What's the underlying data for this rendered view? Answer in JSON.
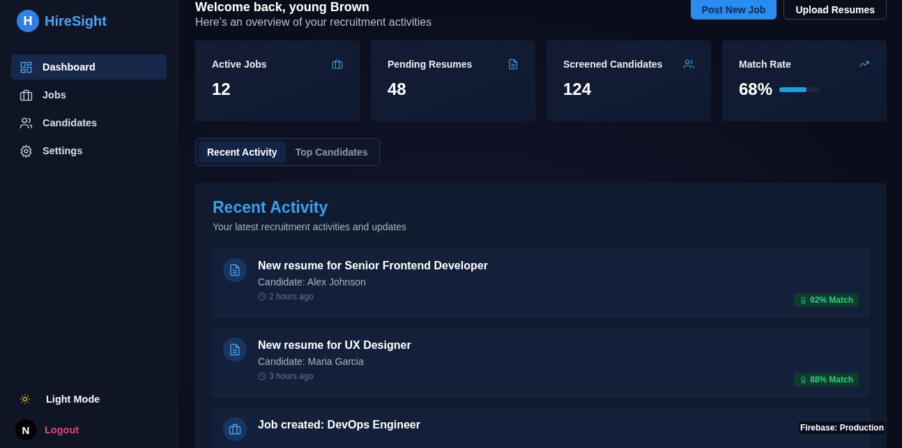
{
  "brand": {
    "initial": "H",
    "name": "HireSight"
  },
  "nav": [
    {
      "label": "Dashboard",
      "kind": "dashboard",
      "selected": true
    },
    {
      "label": "Jobs",
      "kind": "briefcase",
      "selected": false
    },
    {
      "label": "Candidates",
      "kind": "users",
      "selected": false
    },
    {
      "label": "Settings",
      "kind": "gear",
      "selected": false
    }
  ],
  "theme_toggle": {
    "label": "Light Mode"
  },
  "logout": {
    "label": "Logout"
  },
  "dev_badge": {
    "initial": "N"
  },
  "header": {
    "title": "Welcome back, young Brown",
    "subtitle": "Here's an overview of your recruitment activities"
  },
  "actions": [
    {
      "label": "Post New Job",
      "kind": "primary"
    },
    {
      "label": "Upload Resumes",
      "kind": "outline"
    }
  ],
  "stats": [
    {
      "label": "Active Jobs",
      "value": "12",
      "kind": "briefcase"
    },
    {
      "label": "Pending Resumes",
      "value": "48",
      "kind": "file"
    },
    {
      "label": "Screened Candidates",
      "value": "124",
      "kind": "users"
    },
    {
      "label": "Match Rate",
      "value": "68%",
      "kind": "trend",
      "level": 0.68
    }
  ],
  "tabs": [
    {
      "label": "Recent Activity",
      "selected": true
    },
    {
      "label": "Top Candidates",
      "selected": false
    }
  ],
  "panel": {
    "title": "Recent Activity",
    "subtitle": "Your latest recruitment activities and updates"
  },
  "activities": [
    {
      "kind": "file",
      "title": "New resume for Senior Frontend Developer",
      "detail": "Candidate: Alex Johnson",
      "time": "2 hours ago",
      "match": "92% Match"
    },
    {
      "kind": "file",
      "title": "New resume for UX Designer",
      "detail": "Candidate: Maria Garcia",
      "time": "3 hours ago",
      "match": "88% Match"
    },
    {
      "kind": "briefcase",
      "title": "Job created: DevOps Engineer"
    }
  ],
  "env_badge": {
    "label": "Firebase: Production"
  }
}
